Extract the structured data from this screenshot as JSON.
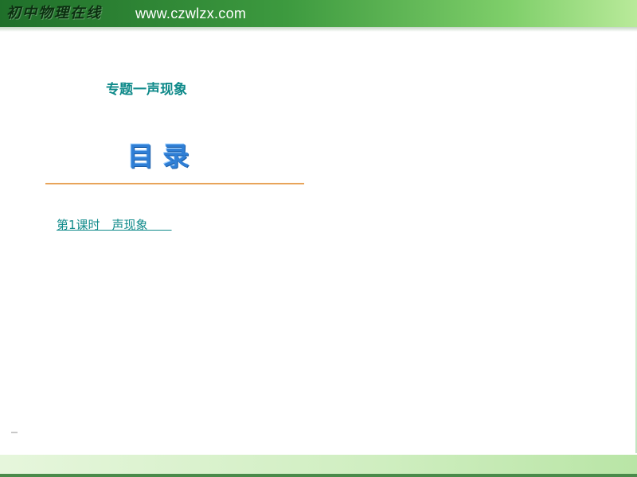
{
  "banner": {
    "brand_text": "初中物理在线",
    "url_text": "www.czwlzx.com"
  },
  "slide": {
    "subject_title": "专题一声现象",
    "toc_heading": "目    录",
    "lesson_link": "第1课时　声现象　　"
  },
  "colors": {
    "banner_green": "#2e8b3a",
    "title_teal": "#0f8a8a",
    "heading_blue": "#2f7fd6",
    "divider_orange": "#e8a45a"
  }
}
